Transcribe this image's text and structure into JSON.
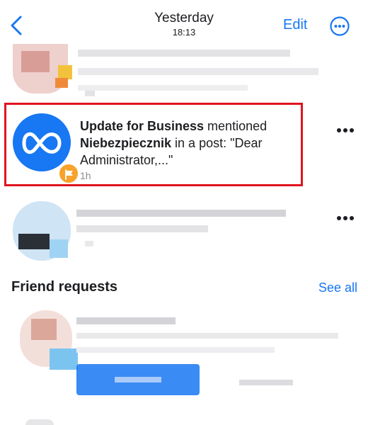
{
  "header": {
    "title": "Yesterday",
    "time": "18:13",
    "edit_label": "Edit"
  },
  "notification": {
    "actor": "Update for Business",
    "verb": " mentioned ",
    "target": "Niebezpiecznik",
    "rest": " in a post: \"Dear Administrator,...\"",
    "time": "1h"
  },
  "friend_requests": {
    "title": "Friend requests",
    "see_all_label": "See all"
  },
  "colors": {
    "accent": "#1877f2",
    "highlight_border": "#e0141e",
    "badge": "#f7a22b"
  },
  "icons": [
    "back-chevron-icon",
    "more-circle-icon",
    "meta-logo-icon",
    "flag-icon",
    "more-dots-icon"
  ]
}
